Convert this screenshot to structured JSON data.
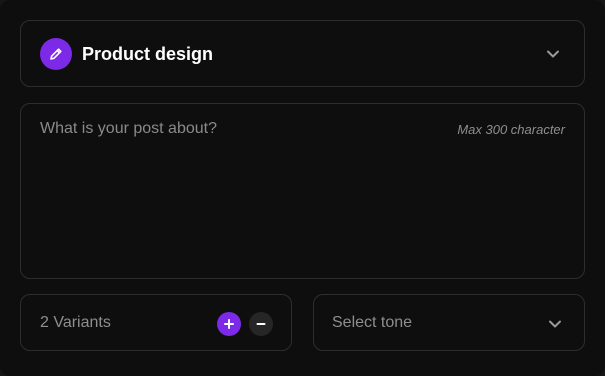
{
  "colors": {
    "accent": "#7c2ae8",
    "background": "#0e0e0e",
    "border": "#2e2e2e"
  },
  "category": {
    "icon": "pencil-icon",
    "label": "Product design",
    "dropdown_icon": "chevron-down-icon"
  },
  "post": {
    "placeholder": "What is your post about?",
    "char_limit_hint": "Max 300 character"
  },
  "variants": {
    "label": "2 Variants",
    "increment_icon": "plus-icon",
    "decrement_icon": "minus-icon"
  },
  "tone": {
    "placeholder": "Select tone",
    "dropdown_icon": "chevron-down-icon"
  }
}
